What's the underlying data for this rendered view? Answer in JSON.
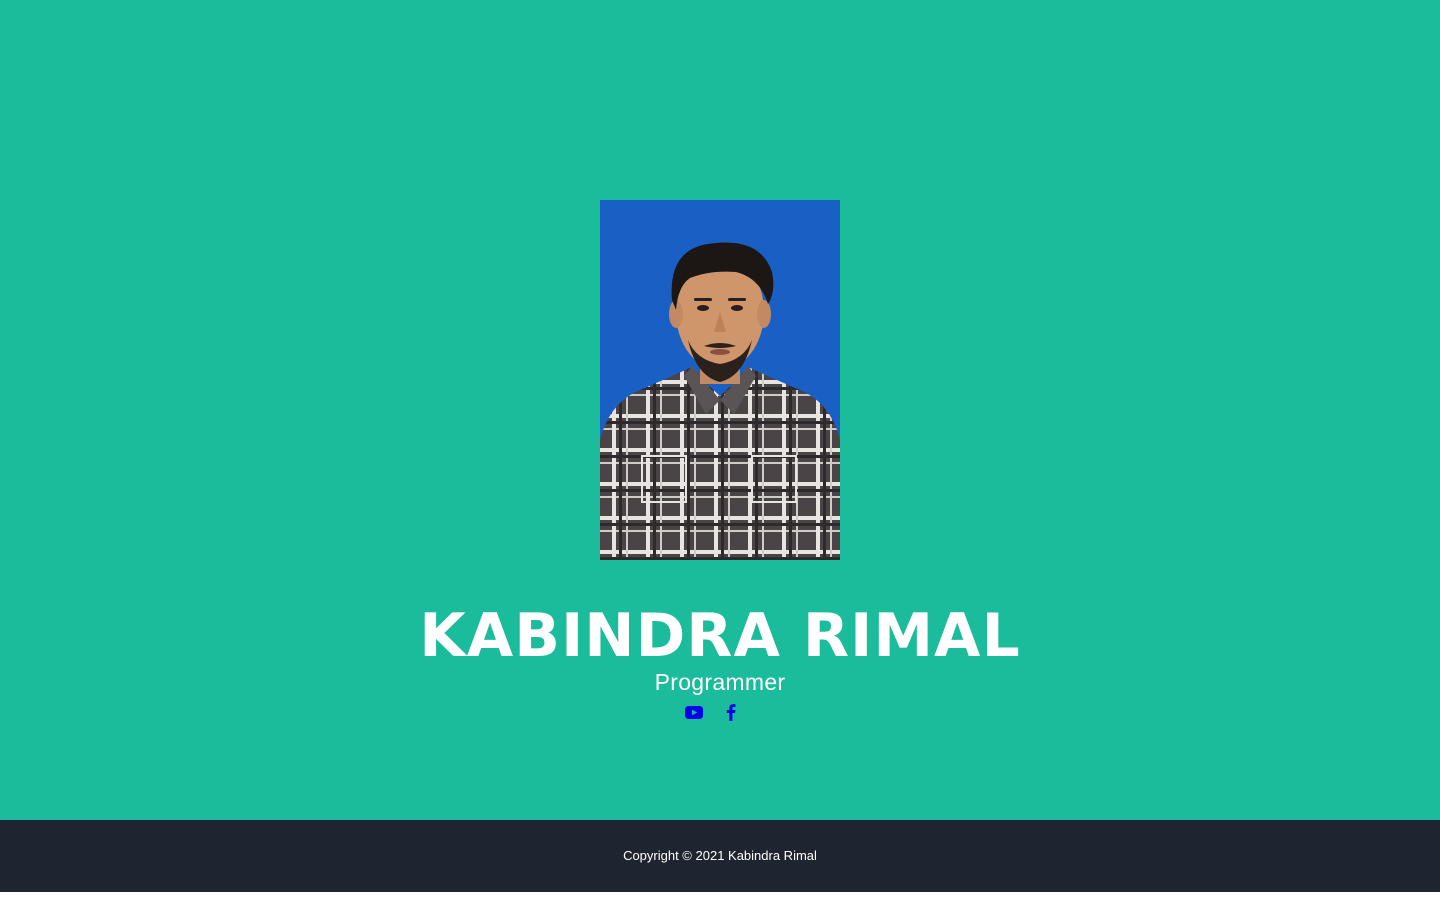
{
  "profile": {
    "name": "KABINDRA RIMAL",
    "role": "Programmer",
    "photo_icon": "person-portrait"
  },
  "social": {
    "youtube_icon": "youtube-icon",
    "facebook_icon": "facebook-icon"
  },
  "footer": {
    "copyright": "Copyright © 2021 Kabindra Rimal"
  },
  "colors": {
    "hero_bg": "#1abc9c",
    "footer_bg": "#1e2430",
    "photo_bg": "#1a5fc4",
    "icon_color": "#0000ee",
    "text": "#ffffff"
  }
}
